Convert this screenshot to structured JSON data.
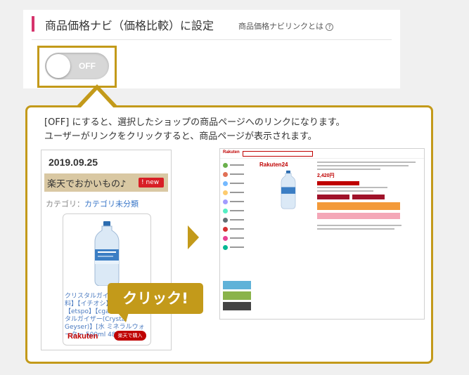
{
  "settings": {
    "title": "商品価格ナビ（価格比較）に設定",
    "help_link": "商品価格ナビリンクとは",
    "help_icon": "question-circle-icon",
    "toggle_state": "OFF",
    "accent_color": "#c39a1a",
    "header_bar_color": "#d6336c"
  },
  "explanation": {
    "line1": "[OFF] にすると、選択したショップの商品ページへのリンクになります。",
    "line2": "ユーザーがリンクをクリックすると、商品ページが表示されます。"
  },
  "blog_card": {
    "date": "2019.09.25",
    "title": "楽天でおかいもの♪",
    "badge": "new",
    "badge_icon": "exclamation-icon",
    "category_label": "カテゴリ：",
    "category_value": "カテゴリ未分類",
    "product_name": "クリスタルガイザー【送料無料】【イチオシ】【bnad01】【etspo】【cga01】【クリスタルガイザー(Crystal Geyser)】[水 ミネラルウォーター 500ml 48本入]",
    "shop_logo": "Rakuten",
    "buy_label": "楽天で購入"
  },
  "click_bubble": "クリック!",
  "arrow_icon": "triangle-right-icon",
  "product_page": {
    "site_logo": "Rakuten",
    "main_logo": "Rakuten24",
    "price": "2,420円"
  }
}
